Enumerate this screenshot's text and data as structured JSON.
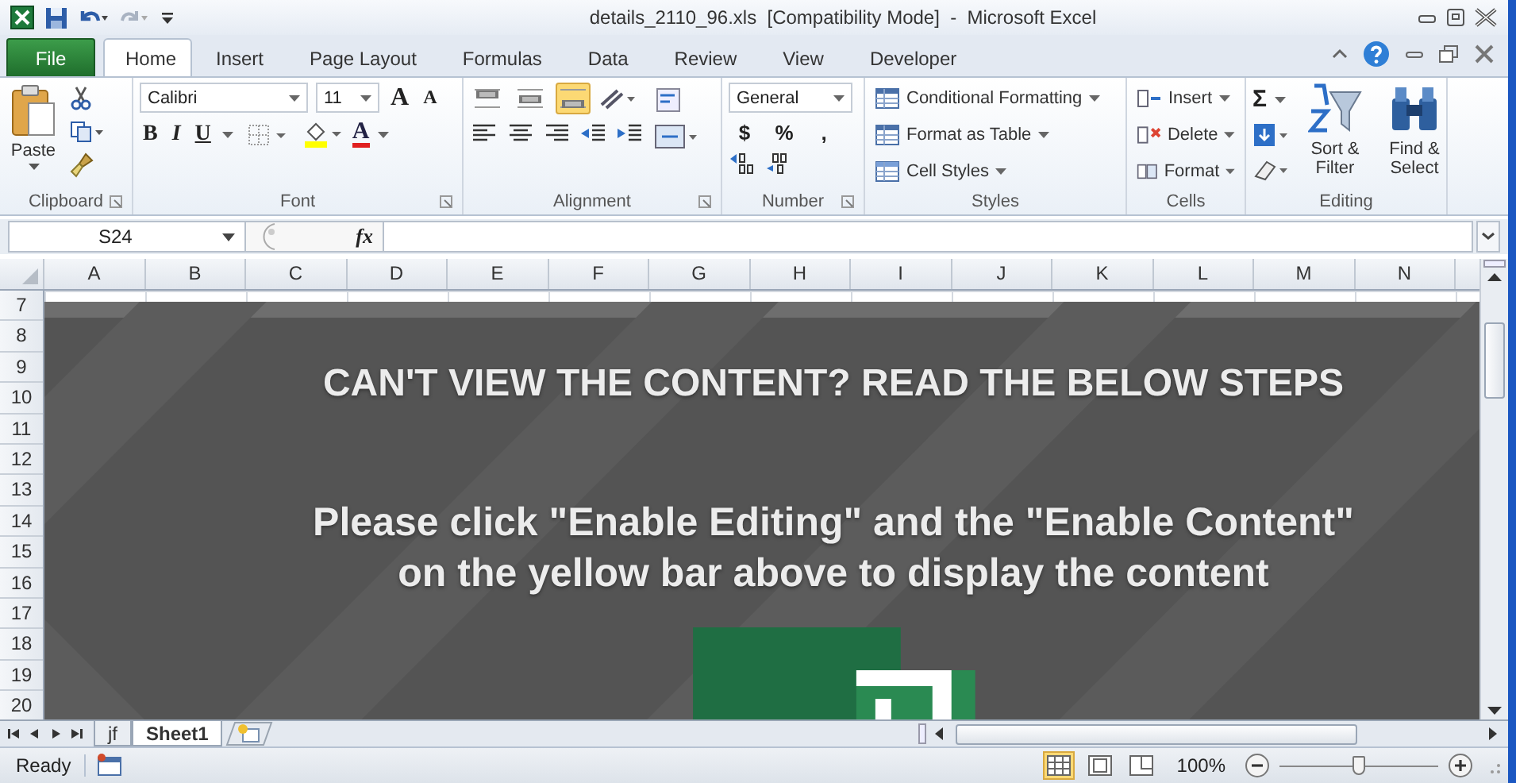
{
  "window": {
    "title": "details_2110_96.xls  [Compatibility Mode]  -  Microsoft Excel"
  },
  "tabs": [
    {
      "label": "File",
      "kind": "file",
      "selected": false
    },
    {
      "label": "Home",
      "kind": "tab",
      "selected": true
    },
    {
      "label": "Insert",
      "kind": "tab",
      "selected": false
    },
    {
      "label": "Page Layout",
      "kind": "tab",
      "selected": false
    },
    {
      "label": "Formulas",
      "kind": "tab",
      "selected": false
    },
    {
      "label": "Data",
      "kind": "tab",
      "selected": false
    },
    {
      "label": "Review",
      "kind": "tab",
      "selected": false
    },
    {
      "label": "View",
      "kind": "tab",
      "selected": false
    },
    {
      "label": "Developer",
      "kind": "tab",
      "selected": false
    }
  ],
  "ribbon": {
    "clipboard": {
      "paste": "Paste",
      "label": "Clipboard"
    },
    "font": {
      "name": "Calibri",
      "size": "11",
      "grow": "A",
      "shrink": "A",
      "styles": [
        "B",
        "I",
        "U"
      ],
      "color_letter": "A",
      "label": "Font"
    },
    "alignment": {
      "vertical": [
        {
          "selected": false
        },
        {
          "selected": false
        },
        {
          "selected": true
        }
      ],
      "label": "Alignment"
    },
    "number": {
      "format": "General",
      "symbols": [
        "$",
        "%",
        ","
      ],
      "label": "Number"
    },
    "styles": {
      "items": [
        "Conditional Formatting",
        "Format as Table",
        "Cell Styles"
      ],
      "label": "Styles"
    },
    "cells": {
      "items": [
        "Insert",
        "Delete",
        "Format"
      ],
      "label": "Cells"
    },
    "editing": {
      "sum": "Σ",
      "items": [
        "Sort & Filter",
        "Find & Select"
      ],
      "label": "Editing"
    }
  },
  "name_box": "S24",
  "formula_label": "fx",
  "columns": [
    "A",
    "B",
    "C",
    "D",
    "E",
    "F",
    "G",
    "H",
    "I",
    "J",
    "K",
    "L",
    "M",
    "N"
  ],
  "rows": [
    "7",
    "8",
    "9",
    "10",
    "11",
    "12",
    "13",
    "14",
    "15",
    "16",
    "17",
    "18",
    "19",
    "20"
  ],
  "notice": {
    "heading": "CAN'T VIEW THE CONTENT? READ THE BELOW STEPS",
    "lines": [
      "Please click \"Enable Editing\" and the \"Enable Content\"",
      "on the yellow bar above to display the content"
    ]
  },
  "sheet_tabs": [
    {
      "label": "jf",
      "selected": false
    },
    {
      "label": "Sheet1",
      "selected": true
    }
  ],
  "status": {
    "text": "Ready",
    "views": [
      {
        "selected": true
      },
      {
        "selected": false
      },
      {
        "selected": false
      }
    ],
    "zoom": "100%",
    "zoom_slider": {
      "level": 0.5
    }
  }
}
